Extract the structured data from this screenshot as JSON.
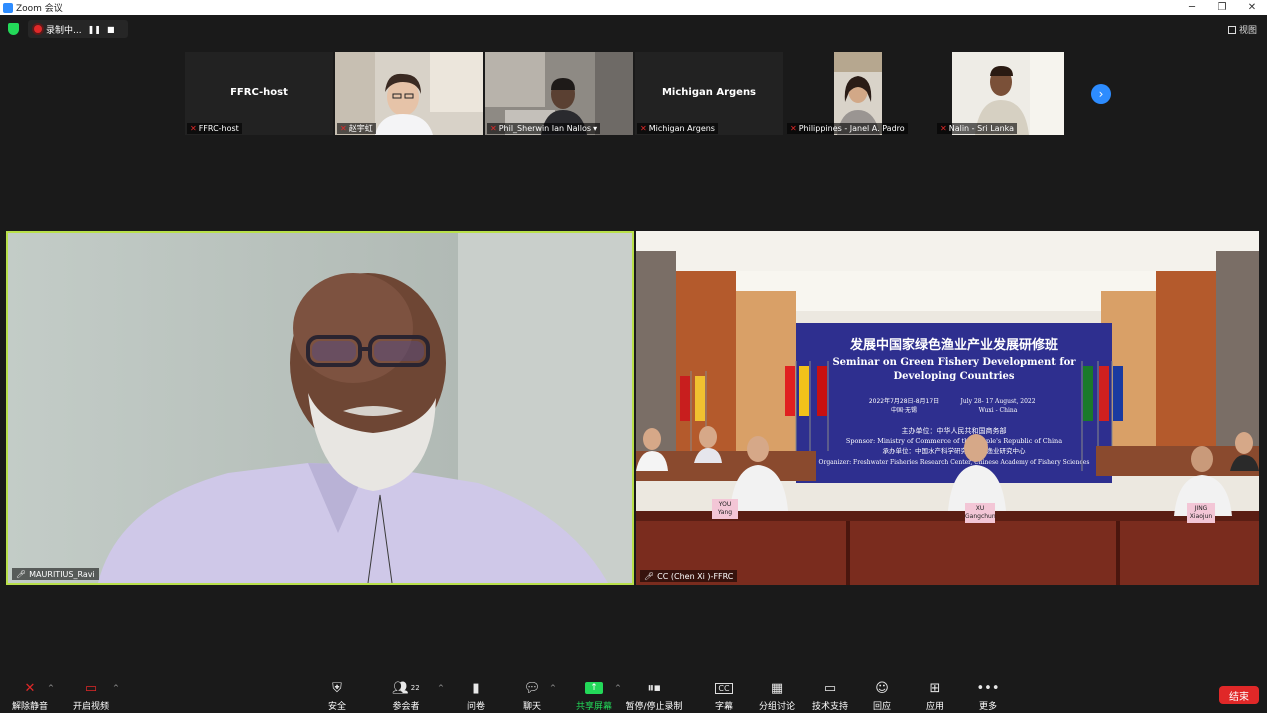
{
  "window": {
    "title": "Zoom 会议",
    "minimize": "─",
    "maximize": "❐",
    "close": "✕"
  },
  "topbar": {
    "recording_label": "录制中...",
    "pause": "❚❚",
    "stop": "■",
    "view_label": "视图"
  },
  "gallery": [
    {
      "name": "FFRC-host",
      "display": "FFRC-host",
      "video": false
    },
    {
      "name": "赵宇虹",
      "video": true
    },
    {
      "name": "Phil_Sherwin Ian Nallos",
      "video": true
    },
    {
      "name": "Michigan Argens",
      "display": "Michigan Argens",
      "video": false
    },
    {
      "name": "Philippines - Janel A. Padro",
      "video": true
    },
    {
      "name": "Nalin - Sri Lanka",
      "video": true
    }
  ],
  "main": {
    "left_name": "MAURITIUS_Ravi",
    "right_name": "CC (Chen Xi )-FFRC",
    "banner": {
      "cn_title": "发展中国家绿色渔业产业发展研修班",
      "en_title_1": "Seminar on Green Fishery Development for",
      "en_title_2": "Developing Countries",
      "date_cn": "2022年7月28日-8月17日",
      "place_cn": "中国·无锡",
      "date_en": "July 28- 17 August, 2022",
      "place_en": "Wuxi - China",
      "sponsor_cn": "主办单位：中华人民共和国商务部",
      "sponsor_en": "Sponsor: Ministry of Commerce of the People's Republic of China",
      "organizer_cn": "承办单位：中国水产科学研究院淡水渔业研究中心",
      "organizer_en": "Organizer: Freshwater Fisheries Research Center, Chinese Academy of Fishery Sciences"
    },
    "nameplates": [
      {
        "line1": "YOU",
        "line2": "Yang"
      },
      {
        "line1": "XU",
        "line2": "Gangchun"
      },
      {
        "line1": "JING",
        "line2": "Xiaojun"
      }
    ]
  },
  "toolbar": {
    "unmute": "解除静音",
    "start_video": "开启视频",
    "security": "安全",
    "participants": "参会者",
    "participants_count": "22",
    "polls": "问卷",
    "chat": "聊天",
    "share": "共享屏幕",
    "pause_recording": "暂停/停止录制",
    "captions": "字幕",
    "breakout": "分组讨论",
    "support": "技术支持",
    "reactions": "回应",
    "apps": "应用",
    "more": "更多",
    "end": "结束"
  },
  "colors": {
    "accent": "#2d8cff",
    "active_speaker": "#b9e04a",
    "end": "#e02828",
    "share": "#23d959"
  }
}
